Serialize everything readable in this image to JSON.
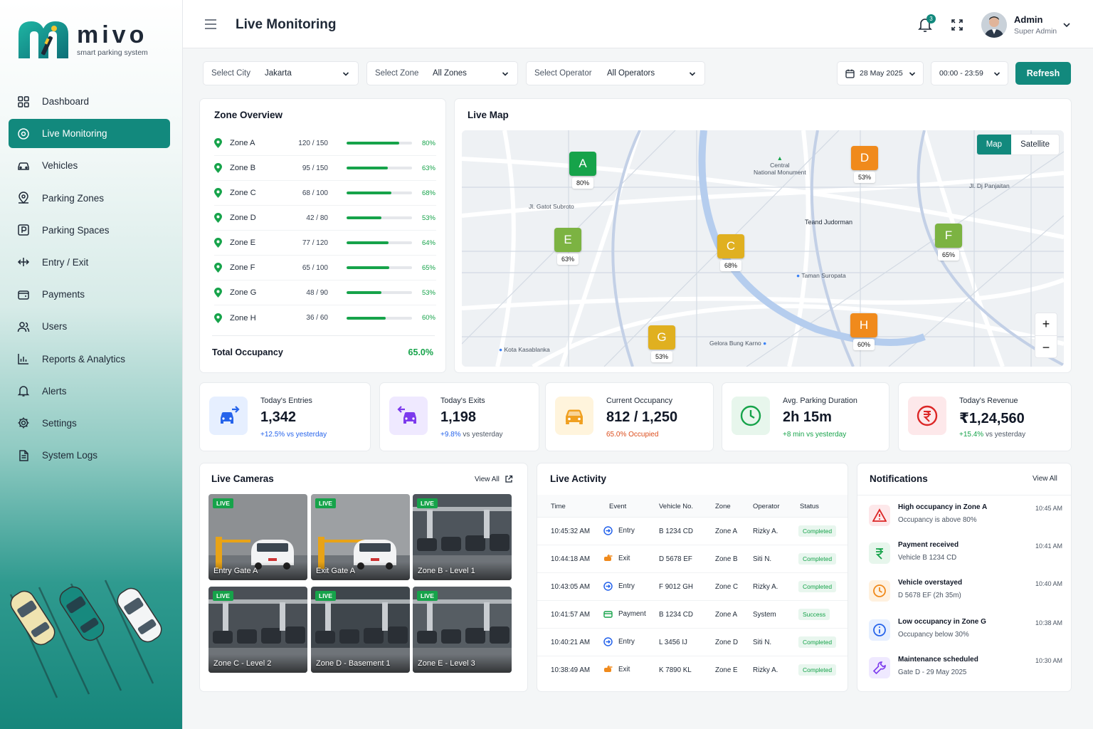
{
  "brand": {
    "name": "mivo",
    "tagline": "smart parking system"
  },
  "nav": [
    {
      "label": "Dashboard",
      "icon": "dashboard-icon"
    },
    {
      "label": "Live Monitoring",
      "icon": "monitor-icon",
      "active": true
    },
    {
      "label": "Vehicles",
      "icon": "car-icon"
    },
    {
      "label": "Parking Zones",
      "icon": "map-pin-icon"
    },
    {
      "label": "Parking Spaces",
      "icon": "parking-icon"
    },
    {
      "label": "Entry / Exit",
      "icon": "entry-exit-icon"
    },
    {
      "label": "Payments",
      "icon": "wallet-icon"
    },
    {
      "label": "Users",
      "icon": "users-icon"
    },
    {
      "label": "Reports & Analytics",
      "icon": "chart-icon"
    },
    {
      "label": "Alerts",
      "icon": "bell-icon"
    },
    {
      "label": "Settings",
      "icon": "gear-icon"
    },
    {
      "label": "System Logs",
      "icon": "log-icon"
    }
  ],
  "header": {
    "title": "Live Monitoring",
    "notifications_count": "3",
    "user_name": "Admin",
    "user_role": "Super Admin"
  },
  "filters": {
    "city": {
      "label": "Select City",
      "value": "Jakarta"
    },
    "zone": {
      "label": "Select Zone",
      "value": "All Zones"
    },
    "operator": {
      "label": "Select Operator",
      "value": "All Operators"
    },
    "date": "28 May 2025",
    "time": "00:00 - 23:59",
    "refresh": "Refresh"
  },
  "zone_overview": {
    "title": "Zone Overview",
    "zones": [
      {
        "name": "Zone A",
        "count": "120 / 150",
        "pct": "80%",
        "fraction": 0.8
      },
      {
        "name": "Zone B",
        "count": "95 / 150",
        "pct": "63%",
        "fraction": 0.63
      },
      {
        "name": "Zone C",
        "count": "68 / 100",
        "pct": "68%",
        "fraction": 0.68
      },
      {
        "name": "Zone D",
        "count": "42 / 80",
        "pct": "53%",
        "fraction": 0.53
      },
      {
        "name": "Zone E",
        "count": "77 / 120",
        "pct": "64%",
        "fraction": 0.64
      },
      {
        "name": "Zone F",
        "count": "65 / 100",
        "pct": "65%",
        "fraction": 0.65
      },
      {
        "name": "Zone G",
        "count": "48 / 90",
        "pct": "53%",
        "fraction": 0.53
      },
      {
        "name": "Zone H",
        "count": "36 / 60",
        "pct": "60%",
        "fraction": 0.6
      }
    ],
    "total_label": "Total Occupancy",
    "total_value": "65.0%"
  },
  "live_map": {
    "title": "Live Map",
    "toggle": [
      "Map",
      "Satellite"
    ],
    "markers": [
      {
        "letter": "A",
        "pct": "80%",
        "color": "#16a34a"
      },
      {
        "letter": "D",
        "pct": "53%",
        "color": "#f08a1c"
      },
      {
        "letter": "E",
        "pct": "63%",
        "color": "#7cb342"
      },
      {
        "letter": "C",
        "pct": "68%",
        "color": "#e0b020"
      },
      {
        "letter": "F",
        "pct": "65%",
        "color": "#7cb342"
      },
      {
        "letter": "H",
        "pct": "60%",
        "color": "#f08a1c"
      },
      {
        "letter": "G",
        "pct": "53%",
        "color": "#e0b020"
      }
    ],
    "labels": [
      "Central",
      "National Monument",
      "Jl. Gatot Subroto",
      "Teand Judorman",
      "Jl. Dj Panjaitan",
      "Taman Suropata",
      "Kota Kasablanka",
      "Gelora Bung Karno"
    ],
    "zoom_in": "+",
    "zoom_out": "−"
  },
  "stats": [
    {
      "label": "Today's Entries",
      "value": "1,342",
      "sub": "+12.5% vs yesterday",
      "sub_color": "#2563eb",
      "bg": "#e6efff",
      "icon": "car-entry-icon"
    },
    {
      "label": "Today's Exits",
      "value": "1,198",
      "sub_strong": "+9.8%",
      "sub": " vs yesterday",
      "sub_color": "#4b5563",
      "bg": "#efe9ff",
      "icon": "car-exit-icon"
    },
    {
      "label": "Current Occupancy",
      "value": "812 / 1,250",
      "sub": "65.0% Occupied",
      "sub_color": "#dc4d1c",
      "bg": "#fff4dc",
      "icon": "car-icon"
    },
    {
      "label": "Avg. Parking Duration",
      "value": "2h 15m",
      "sub": "+8 min vs yesterday",
      "sub_color": "#16a34a",
      "bg": "#e7f6ec",
      "icon": "clock-icon"
    },
    {
      "label": "Today's Revenue",
      "value": "₹1,24,560",
      "sub_strong": "+15.4%",
      "sub": " vs yesterday",
      "sub_color": "#4b5563",
      "bg": "#fde8ea",
      "icon": "rupee-icon"
    }
  ],
  "cameras": {
    "title": "Live Cameras",
    "view_all": "View All",
    "live": "LIVE",
    "feeds": [
      "Entry Gate A",
      "Exit Gate A",
      "Zone B - Level 1",
      "Zone C - Level 2",
      "Zone D - Basement 1",
      "Zone E - Level 3"
    ]
  },
  "activity": {
    "title": "Live Activity",
    "columns": [
      "Time",
      "Event",
      "Vehicle No.",
      "Zone",
      "Operator",
      "Status"
    ],
    "rows": [
      {
        "time": "10:45:32 AM",
        "event": "Entry",
        "vehicle": "B 1234 CD",
        "zone": "Zone A",
        "operator": "Rizky A.",
        "status": "Completed"
      },
      {
        "time": "10:44:18 AM",
        "event": "Exit",
        "vehicle": "D 5678 EF",
        "zone": "Zone B",
        "operator": "Siti N.",
        "status": "Completed"
      },
      {
        "time": "10:43:05 AM",
        "event": "Entry",
        "vehicle": "F 9012 GH",
        "zone": "Zone C",
        "operator": "Rizky A.",
        "status": "Completed"
      },
      {
        "time": "10:41:57 AM",
        "event": "Payment",
        "vehicle": "B 1234 CD",
        "zone": "Zone A",
        "operator": "System",
        "status": "Success"
      },
      {
        "time": "10:40:21 AM",
        "event": "Entry",
        "vehicle": "L 3456 IJ",
        "zone": "Zone D",
        "operator": "Siti N.",
        "status": "Completed"
      },
      {
        "time": "10:38:49 AM",
        "event": "Exit",
        "vehicle": "K 7890 KL",
        "zone": "Zone E",
        "operator": "Rizky A.",
        "status": "Completed"
      }
    ]
  },
  "notifications": {
    "title": "Notifications",
    "view_all": "View All",
    "items": [
      {
        "title": "High occupancy in Zone A",
        "sub": "Occupancy is above 80%",
        "time": "10:45 AM",
        "icon": "warning-icon",
        "color": "#dc2626",
        "bg": "#fde8ea"
      },
      {
        "title": "Payment received",
        "sub": "Vehicle B 1234 CD",
        "time": "10:41 AM",
        "icon": "rupee-icon",
        "color": "#16a34a",
        "bg": "#e7f6ec"
      },
      {
        "title": "Vehicle overstayed",
        "sub": "D 5678 EF (2h 35m)",
        "time": "10:40 AM",
        "icon": "clock-icon",
        "color": "#f08a1c",
        "bg": "#fff1df"
      },
      {
        "title": "Low occupancy in Zone G",
        "sub": "Occupancy below 30%",
        "time": "10:38 AM",
        "icon": "info-icon",
        "color": "#2563eb",
        "bg": "#e6efff"
      },
      {
        "title": "Maintenance scheduled",
        "sub": "Gate D - 29 May 2025",
        "time": "10:30 AM",
        "icon": "wrench-icon",
        "color": "#7c3aed",
        "bg": "#efe9ff"
      }
    ]
  }
}
